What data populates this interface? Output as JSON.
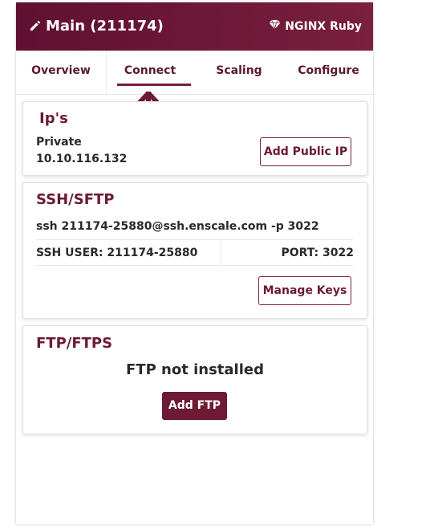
{
  "header": {
    "title": "Main (211174)",
    "badge": "NGINX Ruby"
  },
  "tabs": [
    {
      "label": "Overview"
    },
    {
      "label": "Connect",
      "active": true
    },
    {
      "label": "Scaling"
    },
    {
      "label": "Configure"
    }
  ],
  "ips": {
    "title": "Ip's",
    "private_label": "Private",
    "private_ip": "10.10.116.132",
    "add_public_ip_label": "Add Public IP"
  },
  "ssh": {
    "title": "SSH/SFTP",
    "command": "ssh 211174-25880@ssh.enscale.com -p 3022",
    "user_text": "SSH USER: 211174-25880",
    "port_text": "PORT: 3022",
    "manage_keys_label": "Manage Keys"
  },
  "ftp": {
    "title": "FTP/FTPS",
    "status": "FTP not installed",
    "add_ftp_label": "Add FTP"
  },
  "colors": {
    "brand": "#6f1a35",
    "header_gradient_start": "#5f1030",
    "header_gradient_end": "#7a1f3d"
  },
  "icons": {
    "title_icon": "pencil-icon",
    "badge_icon": "gem-icon",
    "annotation": "up-arrow-icon"
  }
}
